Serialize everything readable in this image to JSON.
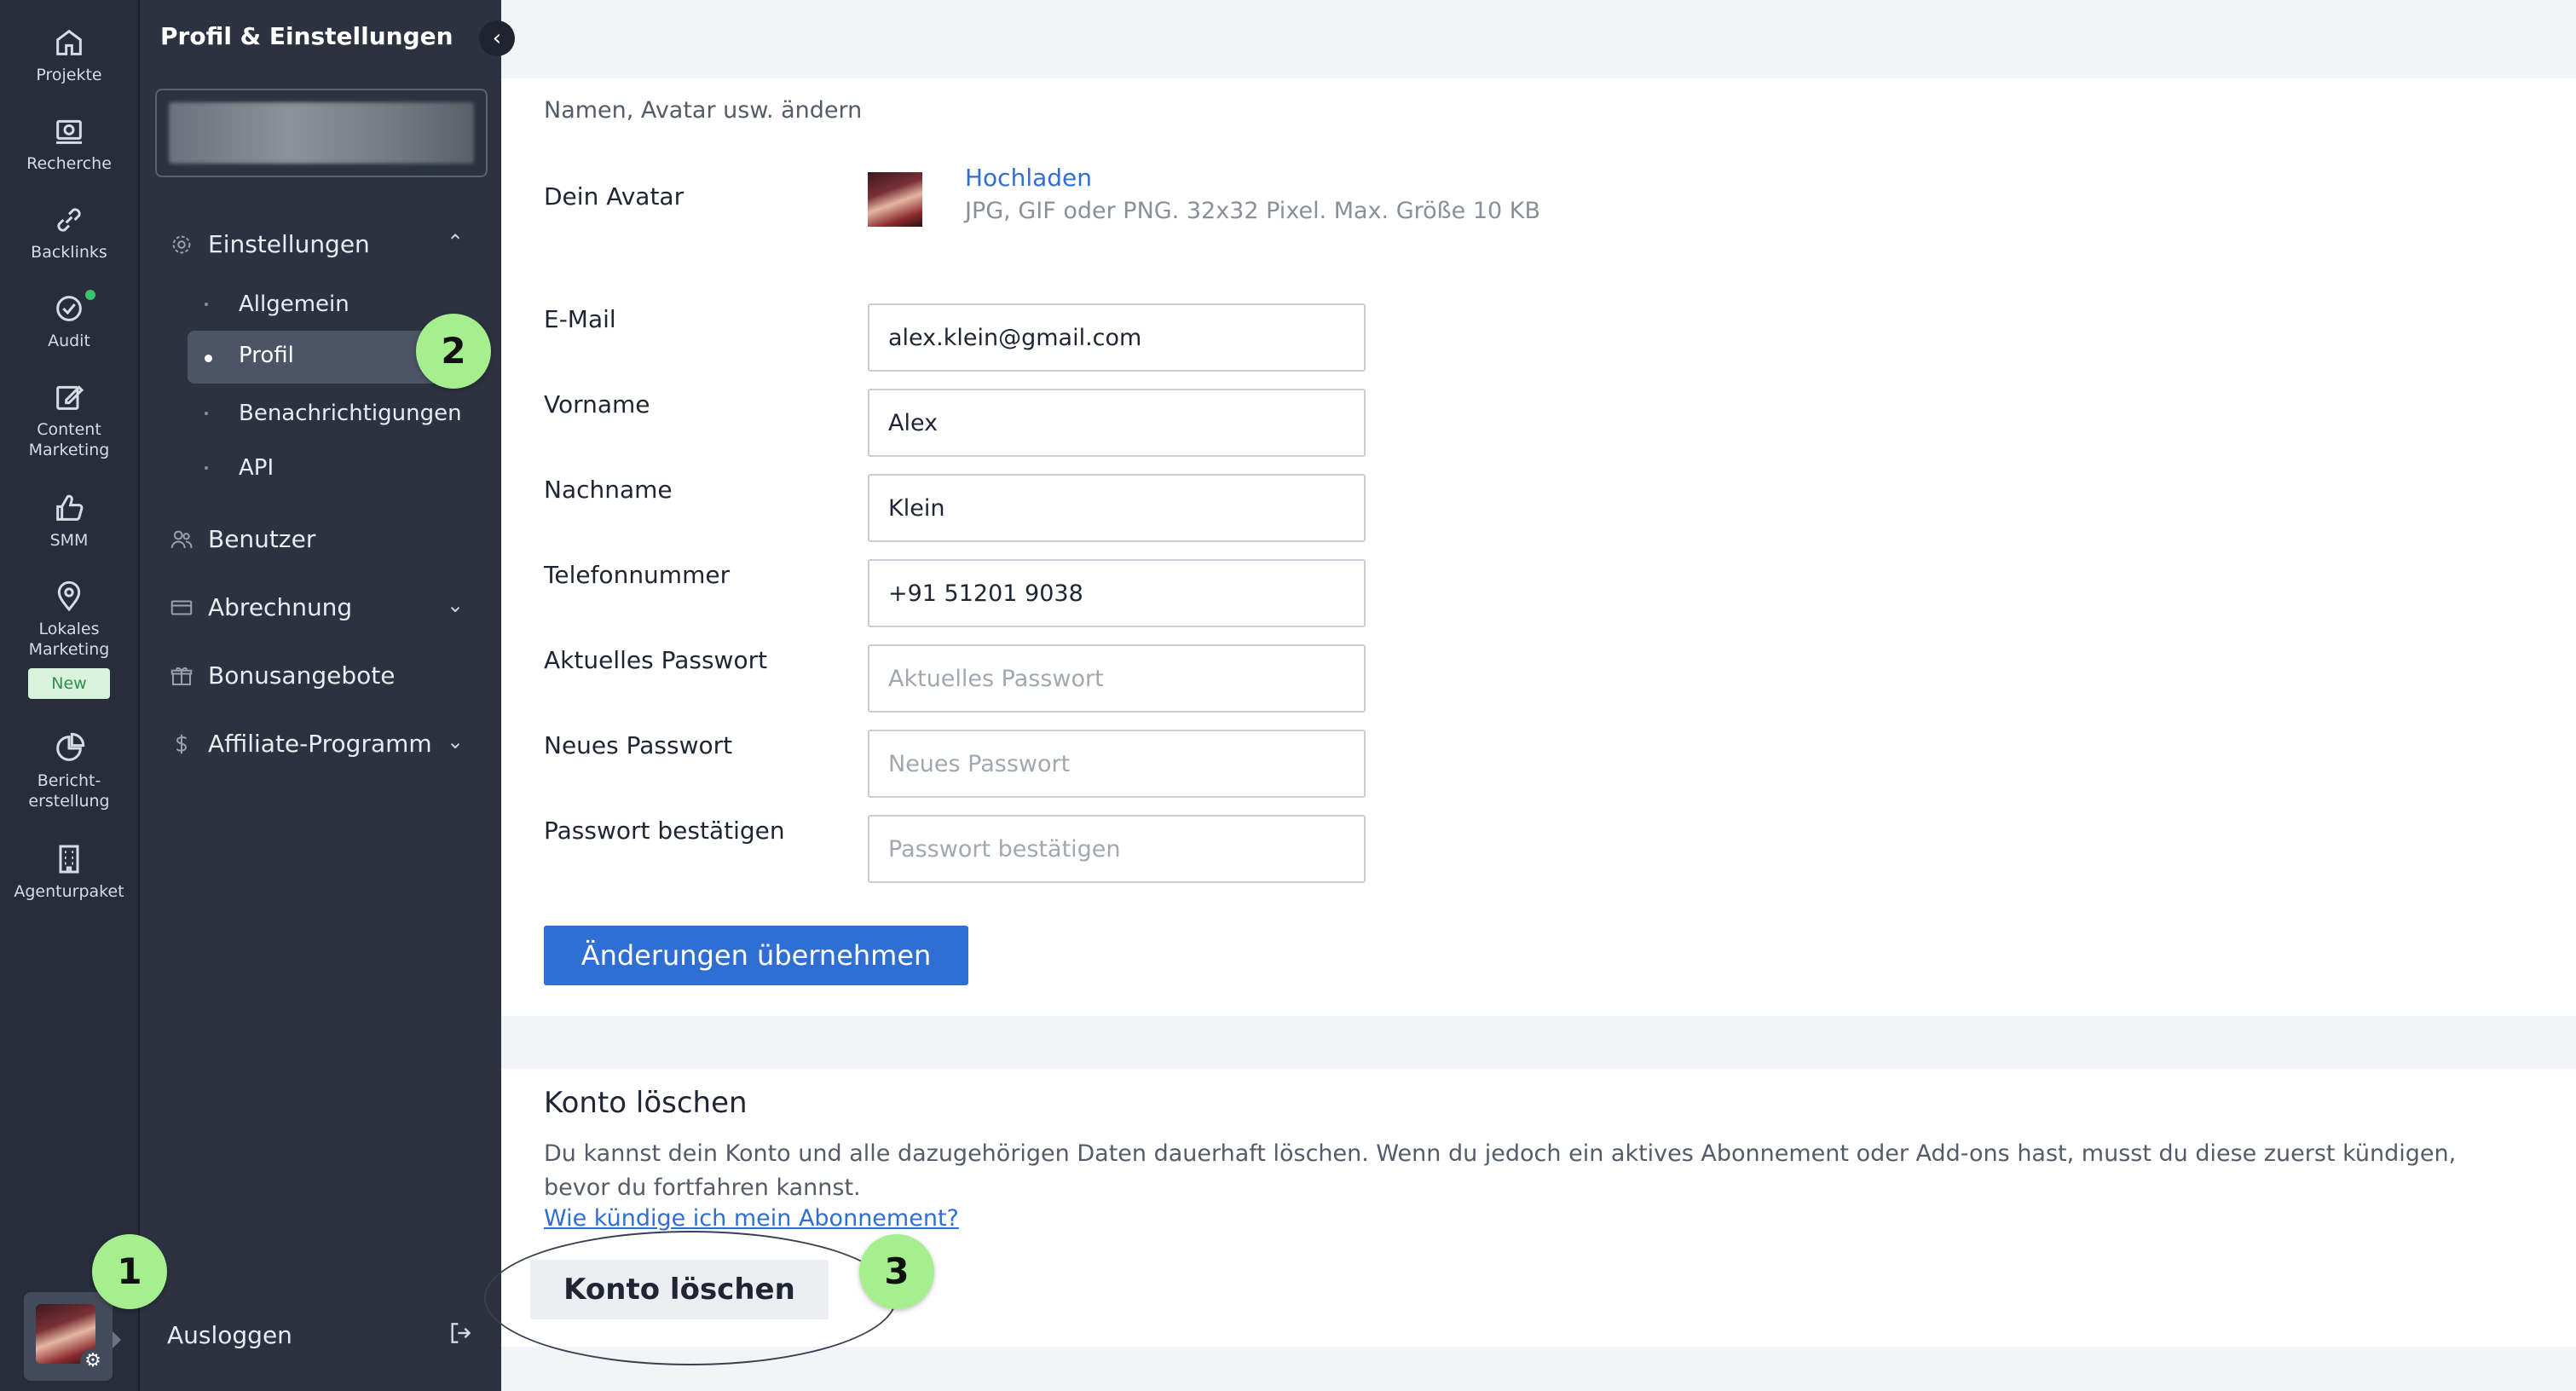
{
  "rail": {
    "items": [
      {
        "label": "Projekte",
        "icon": "home-icon"
      },
      {
        "label": "Recherche",
        "icon": "research-icon"
      },
      {
        "label": "Backlinks",
        "icon": "link-icon"
      },
      {
        "label": "Audit",
        "icon": "audit-check-icon"
      },
      {
        "label": "Content\nMarketing",
        "icon": "edit-icon"
      },
      {
        "label": "SMM",
        "icon": "thumbs-up-icon"
      },
      {
        "label": "Lokales\nMarketing",
        "icon": "map-pin-icon",
        "badge": "New"
      },
      {
        "label": "Bericht-\nerstellung",
        "icon": "pie-chart-icon"
      },
      {
        "label": "Agenturpaket",
        "icon": "building-icon"
      }
    ]
  },
  "sidebar": {
    "title": "Profil & Einstellungen",
    "settings_label": "Einstellungen",
    "sub_items": [
      "Allgemein",
      "Profil",
      "Benachrichtigungen",
      "API"
    ],
    "active_sub_item": "Profil",
    "items": [
      {
        "label": "Benutzer",
        "icon": "users-icon"
      },
      {
        "label": "Abrechnung",
        "icon": "credit-card-icon"
      },
      {
        "label": "Bonusangebote",
        "icon": "gift-icon"
      },
      {
        "label": "Affiliate-Programm",
        "icon": "dollar-icon"
      }
    ],
    "logout_label": "Ausloggen"
  },
  "profile": {
    "intro": "Namen, Avatar usw. ändern",
    "avatar_label": "Dein Avatar",
    "upload_link": "Hochladen",
    "upload_hint": "JPG, GIF oder PNG. 32x32 Pixel. Max. Größe 10 KB",
    "fields": {
      "email": {
        "label": "E-Mail",
        "value": "alex.klein@gmail.com"
      },
      "first_name": {
        "label": "Vorname",
        "value": "Alex"
      },
      "last_name": {
        "label": "Nachname",
        "value": "Klein"
      },
      "phone": {
        "label": "Telefonnummer",
        "value": "+91 51201 9038"
      },
      "current_password": {
        "label": "Aktuelles Passwort",
        "placeholder": "Aktuelles Passwort"
      },
      "new_password": {
        "label": "Neues Passwort",
        "placeholder": "Neues Passwort"
      },
      "confirm_password": {
        "label": "Passwort bestätigen",
        "placeholder": "Passwort bestätigen"
      }
    },
    "save_button": "Änderungen übernehmen"
  },
  "delete_account": {
    "title": "Konto löschen",
    "text": "Du kannst dein Konto und alle dazugehörigen Daten dauerhaft löschen. Wenn du jedoch ein aktives Abonnement oder Add-ons hast, musst du diese zuerst kündigen, bevor du fortfahren kannst.",
    "link": "Wie kündige ich mein Abonnement?",
    "button": "Konto löschen"
  },
  "markers": [
    "1",
    "2",
    "3"
  ],
  "colors": {
    "rail_bg": "#272d3b",
    "sidebar_bg": "#2c3240",
    "accent": "#2f6fd4",
    "marker": "#a6ef8f",
    "new_badge": "#d8f3dc"
  }
}
